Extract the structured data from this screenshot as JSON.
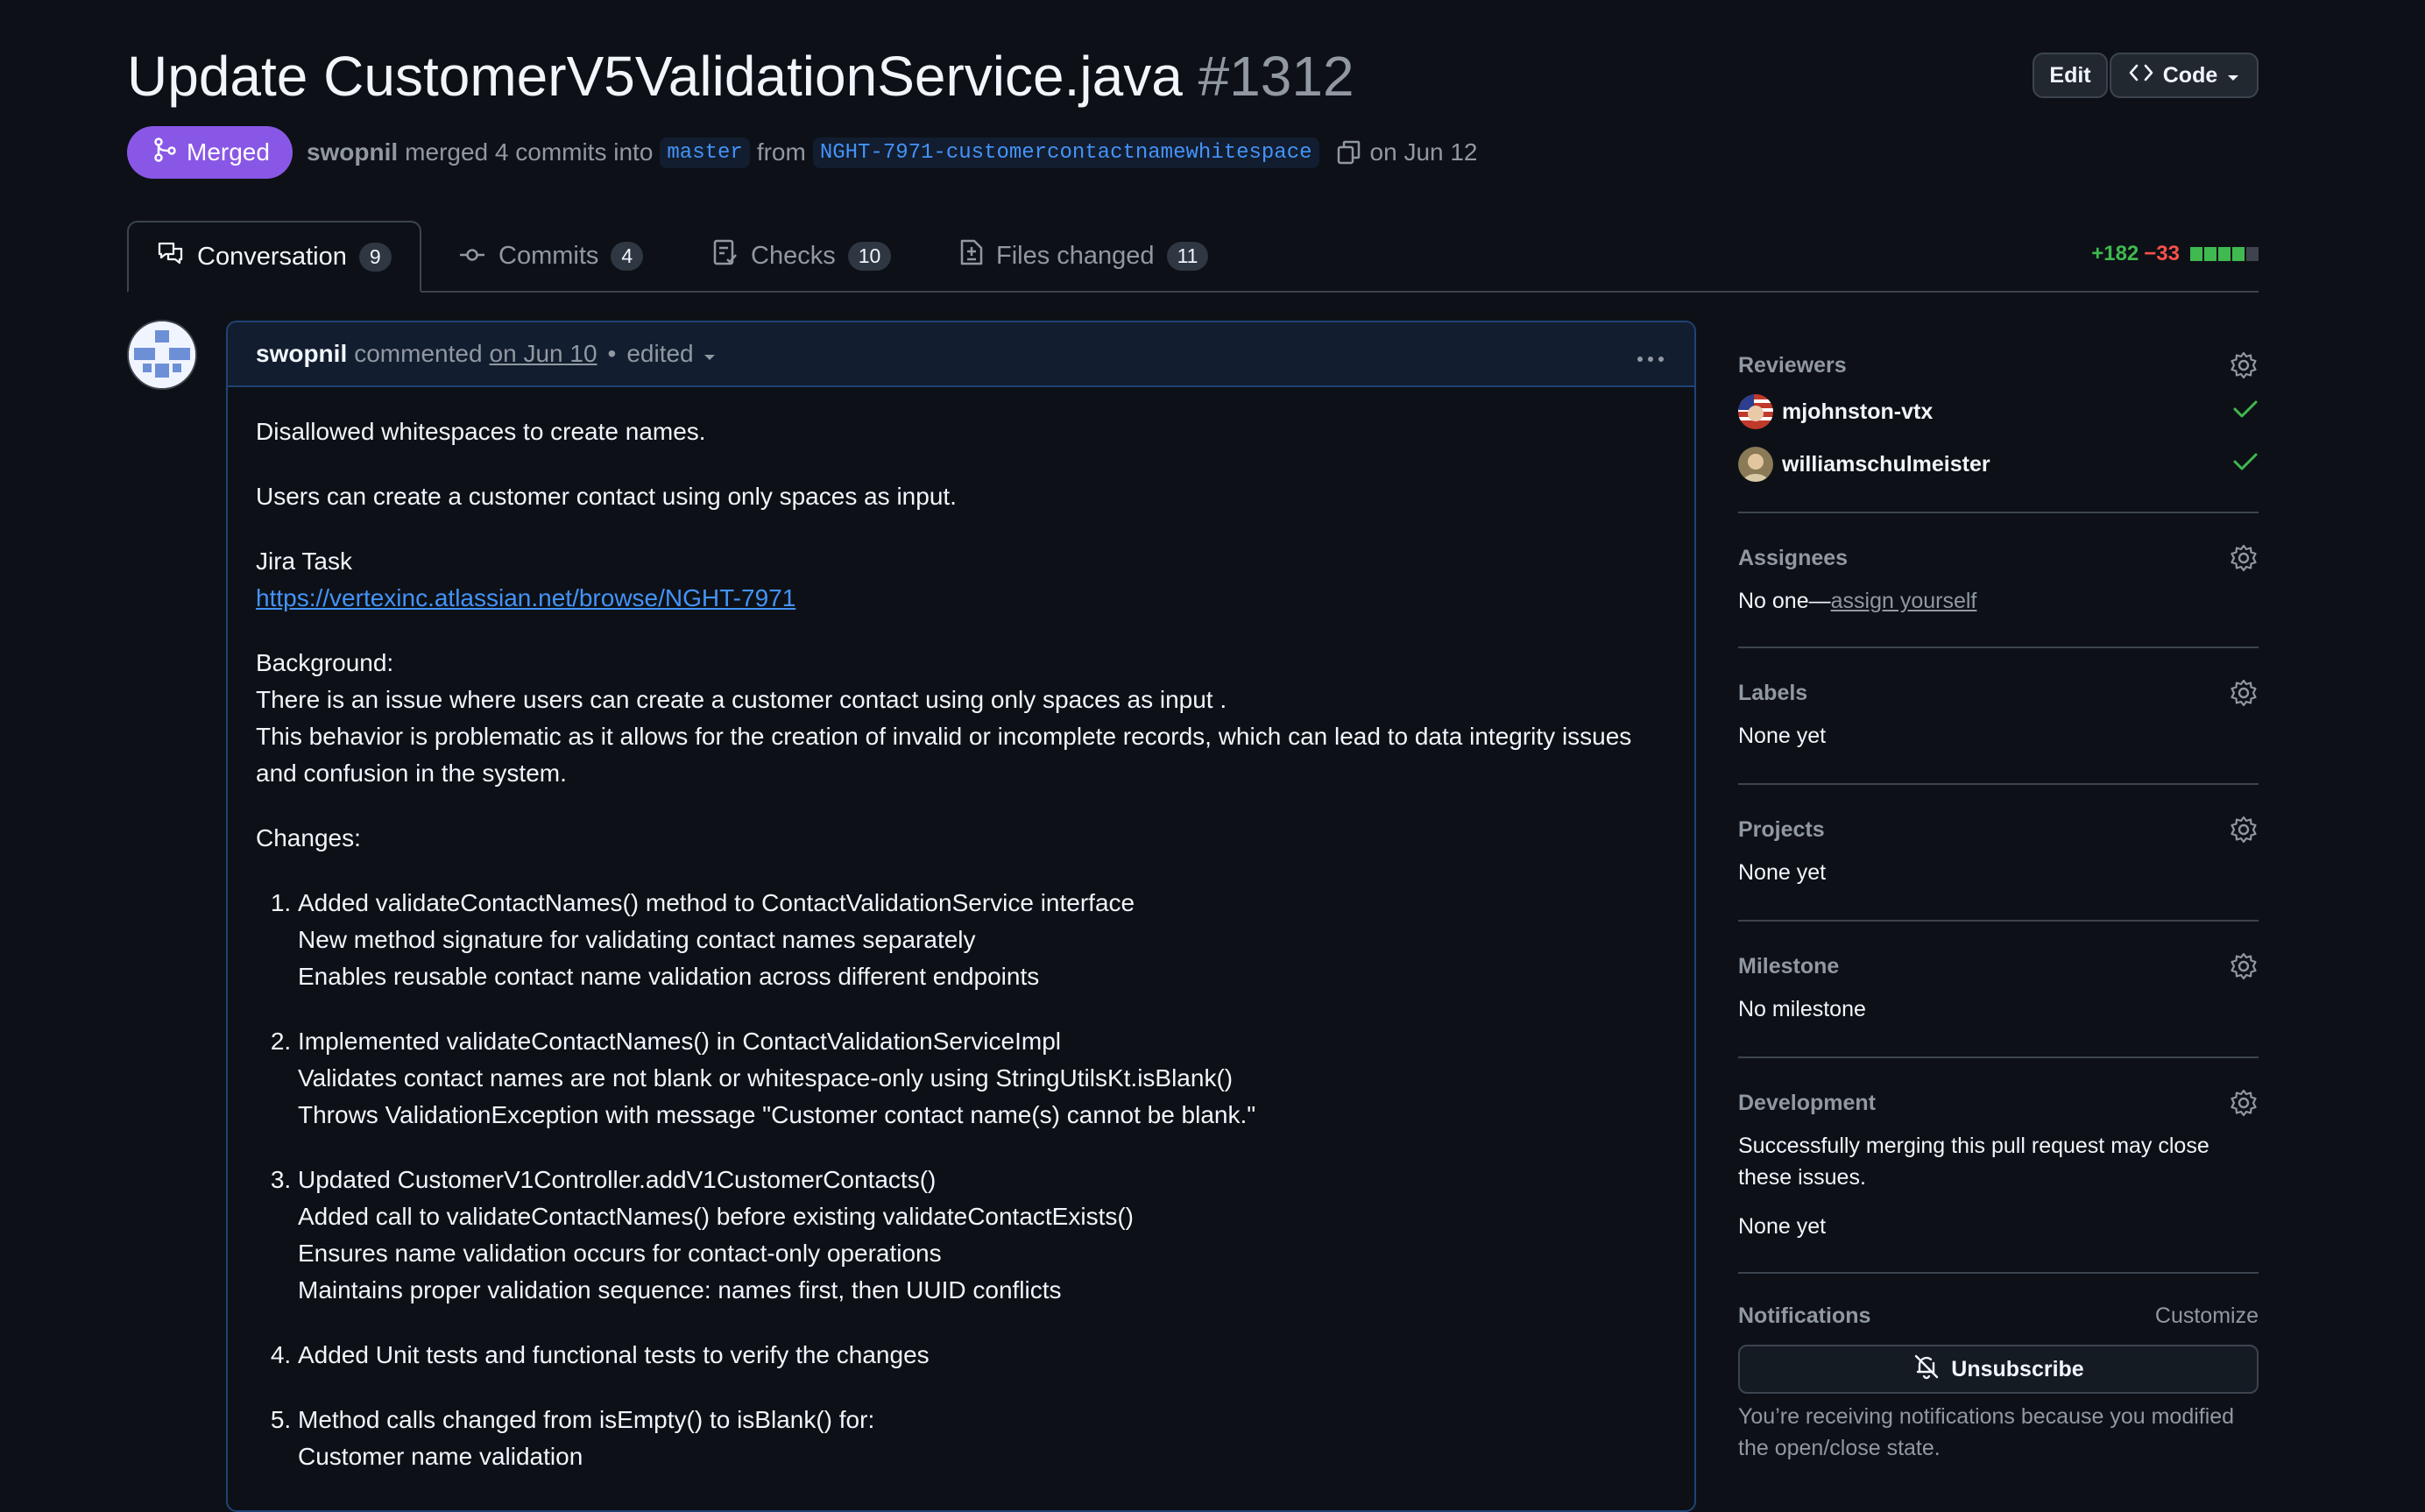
{
  "pr": {
    "title": "Update CustomerV5ValidationService.java",
    "number": "#1312",
    "state": "Merged",
    "author": "swopnil",
    "merge_text": "merged 4 commits into",
    "base_branch": "master",
    "from_text": "from",
    "head_branch": "NGHT-7971-customercontactnamewhitespace",
    "date_text": "on Jun 12"
  },
  "header_buttons": {
    "edit": "Edit",
    "code": "Code"
  },
  "tabs": [
    {
      "label": "Conversation",
      "count": "9"
    },
    {
      "label": "Commits",
      "count": "4"
    },
    {
      "label": "Checks",
      "count": "10"
    },
    {
      "label": "Files changed",
      "count": "11"
    }
  ],
  "diffstat": {
    "additions": "+182",
    "deletions": "−33",
    "blocks": [
      "green",
      "green",
      "green",
      "green",
      "gray"
    ]
  },
  "colors": {
    "accent": "#4493f8",
    "merged": "#8957e5",
    "add": "#3fb950",
    "delete": "#f85149",
    "bg": "#0d1117"
  },
  "comment": {
    "author": "swopnil",
    "action": "commented",
    "date": "on Jun 10",
    "edited": "edited",
    "p1": "Disallowed whitespaces to create names.",
    "p2": "Users can create a customer contact using only spaces as input.",
    "jira_label": "Jira Task",
    "jira_link": "https://vertexinc.atlassian.net/browse/NGHT-7971",
    "bg_title": "Background:",
    "bg_line1": "There is an issue where users can create a customer contact using only spaces as input .",
    "bg_line2": "This behavior is problematic as it allows for the creation of invalid or incomplete records, which can lead to data integrity issues and confusion in the system.",
    "changes_title": "Changes:",
    "changes": [
      {
        "l1": "Added validateContactNames() method to ContactValidationService interface",
        "l2": "New method signature for validating contact names separately",
        "l3": "Enables reusable contact name validation across different endpoints",
        "l4": ""
      },
      {
        "l1": "Implemented validateContactNames() in ContactValidationServiceImpl",
        "l2": "Validates contact names are not blank or whitespace-only using StringUtilsKt.isBlank()",
        "l3": "Throws ValidationException with message \"Customer contact name(s) cannot be blank.\"",
        "l4": ""
      },
      {
        "l1": "Updated CustomerV1Controller.addV1CustomerContacts()",
        "l2": "Added call to validateContactNames() before existing validateContactExists()",
        "l3": "Ensures name validation occurs for contact-only operations",
        "l4": "Maintains proper validation sequence: names first, then UUID conflicts"
      },
      {
        "l1": "Added Unit tests and functional tests to verify the changes",
        "l2": "",
        "l3": "",
        "l4": ""
      },
      {
        "l1": "Method calls changed from isEmpty() to isBlank() for:",
        "l2": "Customer name validation",
        "l3": "",
        "l4": ""
      }
    ]
  },
  "sidebar": {
    "reviewers": {
      "title": "Reviewers",
      "items": [
        {
          "name": "mjohnston-vtx"
        },
        {
          "name": "williamschulmeister"
        }
      ]
    },
    "assignees": {
      "title": "Assignees",
      "text": "No one—",
      "link": "assign yourself"
    },
    "labels": {
      "title": "Labels",
      "text": "None yet"
    },
    "projects": {
      "title": "Projects",
      "text": "None yet"
    },
    "milestone": {
      "title": "Milestone",
      "text": "No milestone"
    },
    "development": {
      "title": "Development",
      "text": "Successfully merging this pull request may close these issues.",
      "none": "None yet"
    },
    "notifications": {
      "title": "Notifications",
      "customize": "Customize",
      "button": "Unsubscribe",
      "reason": "You’re receiving notifications because you modified the open/close state."
    }
  }
}
